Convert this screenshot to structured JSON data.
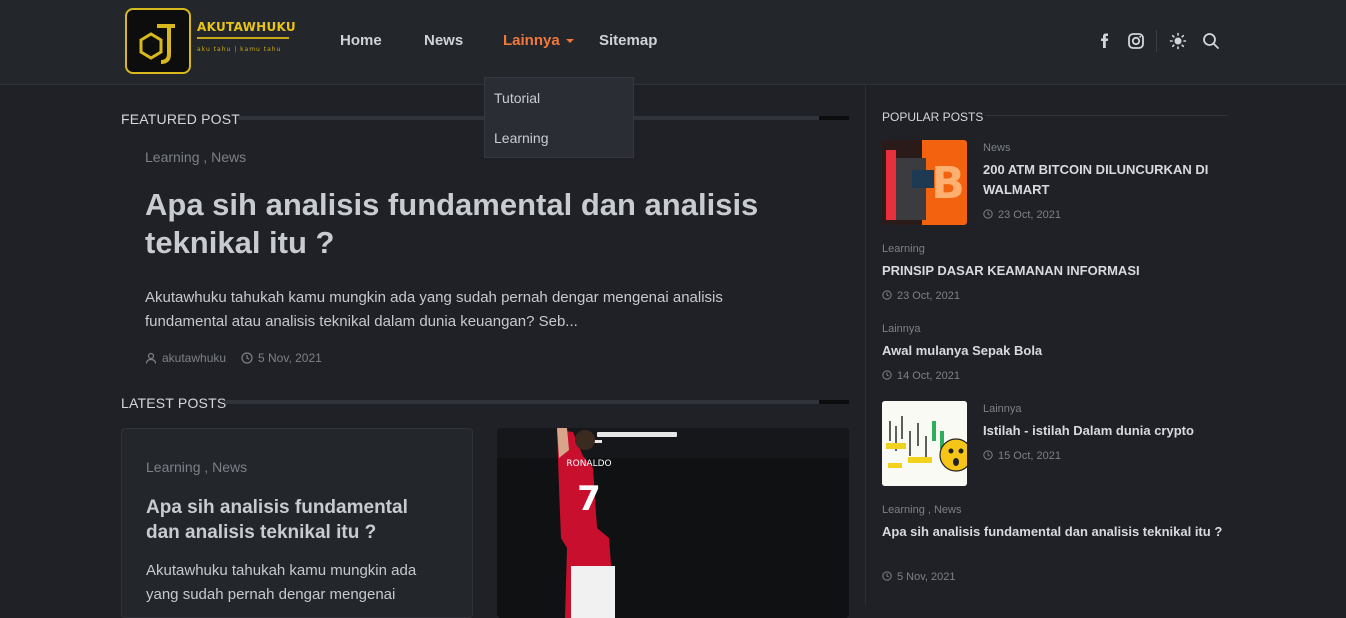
{
  "brand": {
    "name": "AKUTAWHUKU",
    "tagline": "aku tahu | kamu tahu"
  },
  "nav": {
    "items": [
      {
        "label": "Home"
      },
      {
        "label": "News"
      },
      {
        "label": "Lainnya"
      },
      {
        "label": "Sitemap"
      }
    ],
    "dropdown": [
      {
        "label": "Tutorial"
      },
      {
        "label": "Learning"
      }
    ]
  },
  "header_icons": [
    "facebook-icon",
    "instagram-icon",
    "theme-toggle-icon",
    "search-icon"
  ],
  "featured": {
    "section_title": "FEATURED POST",
    "categories": "Learning , News",
    "title": "Apa sih analisis fundamental dan analisis teknikal itu ?",
    "snippet": "Akutawhuku tahukah kamu mungkin ada yang sudah pernah dengar mengenai analisis fundamental atau analisis teknikal dalam dunia keuangan?  Seb...",
    "author": "akutawhuku",
    "date": "5 Nov, 2021"
  },
  "latest": {
    "section_title": "LATEST POSTS",
    "card": {
      "categories": "Learning , News",
      "title": "Apa sih analisis fundamental dan analisis teknikal itu ?",
      "snippet": "Akutawhuku tahukah kamu mungkin ada yang sudah pernah dengar mengenai"
    },
    "image_jersey_text": "RONALDO",
    "image_jersey_number": "7"
  },
  "popular": {
    "section_title": "POPULAR POSTS",
    "items": [
      {
        "category": "News",
        "title": "200 ATM BITCOIN DILUNCURKAN DI WALMART",
        "date": "23 Oct, 2021"
      },
      {
        "category": "Learning",
        "title": "PRINSIP DASAR KEAMANAN INFORMASI",
        "date": "23 Oct, 2021"
      },
      {
        "category": "Lainnya",
        "title": "Awal mulanya Sepak Bola",
        "date": "14 Oct, 2021"
      },
      {
        "category": "Lainnya",
        "title": "Istilah - istilah Dalam dunia crypto",
        "date": "15 Oct, 2021"
      },
      {
        "category": "Learning , News",
        "title": "Apa sih analisis fundamental dan analisis teknikal itu ?",
        "date": "5 Nov, 2021"
      }
    ]
  },
  "colors": {
    "accent": "#f0783c",
    "background": "#1f2126",
    "header": "#23262b",
    "logo": "#e8c319"
  }
}
